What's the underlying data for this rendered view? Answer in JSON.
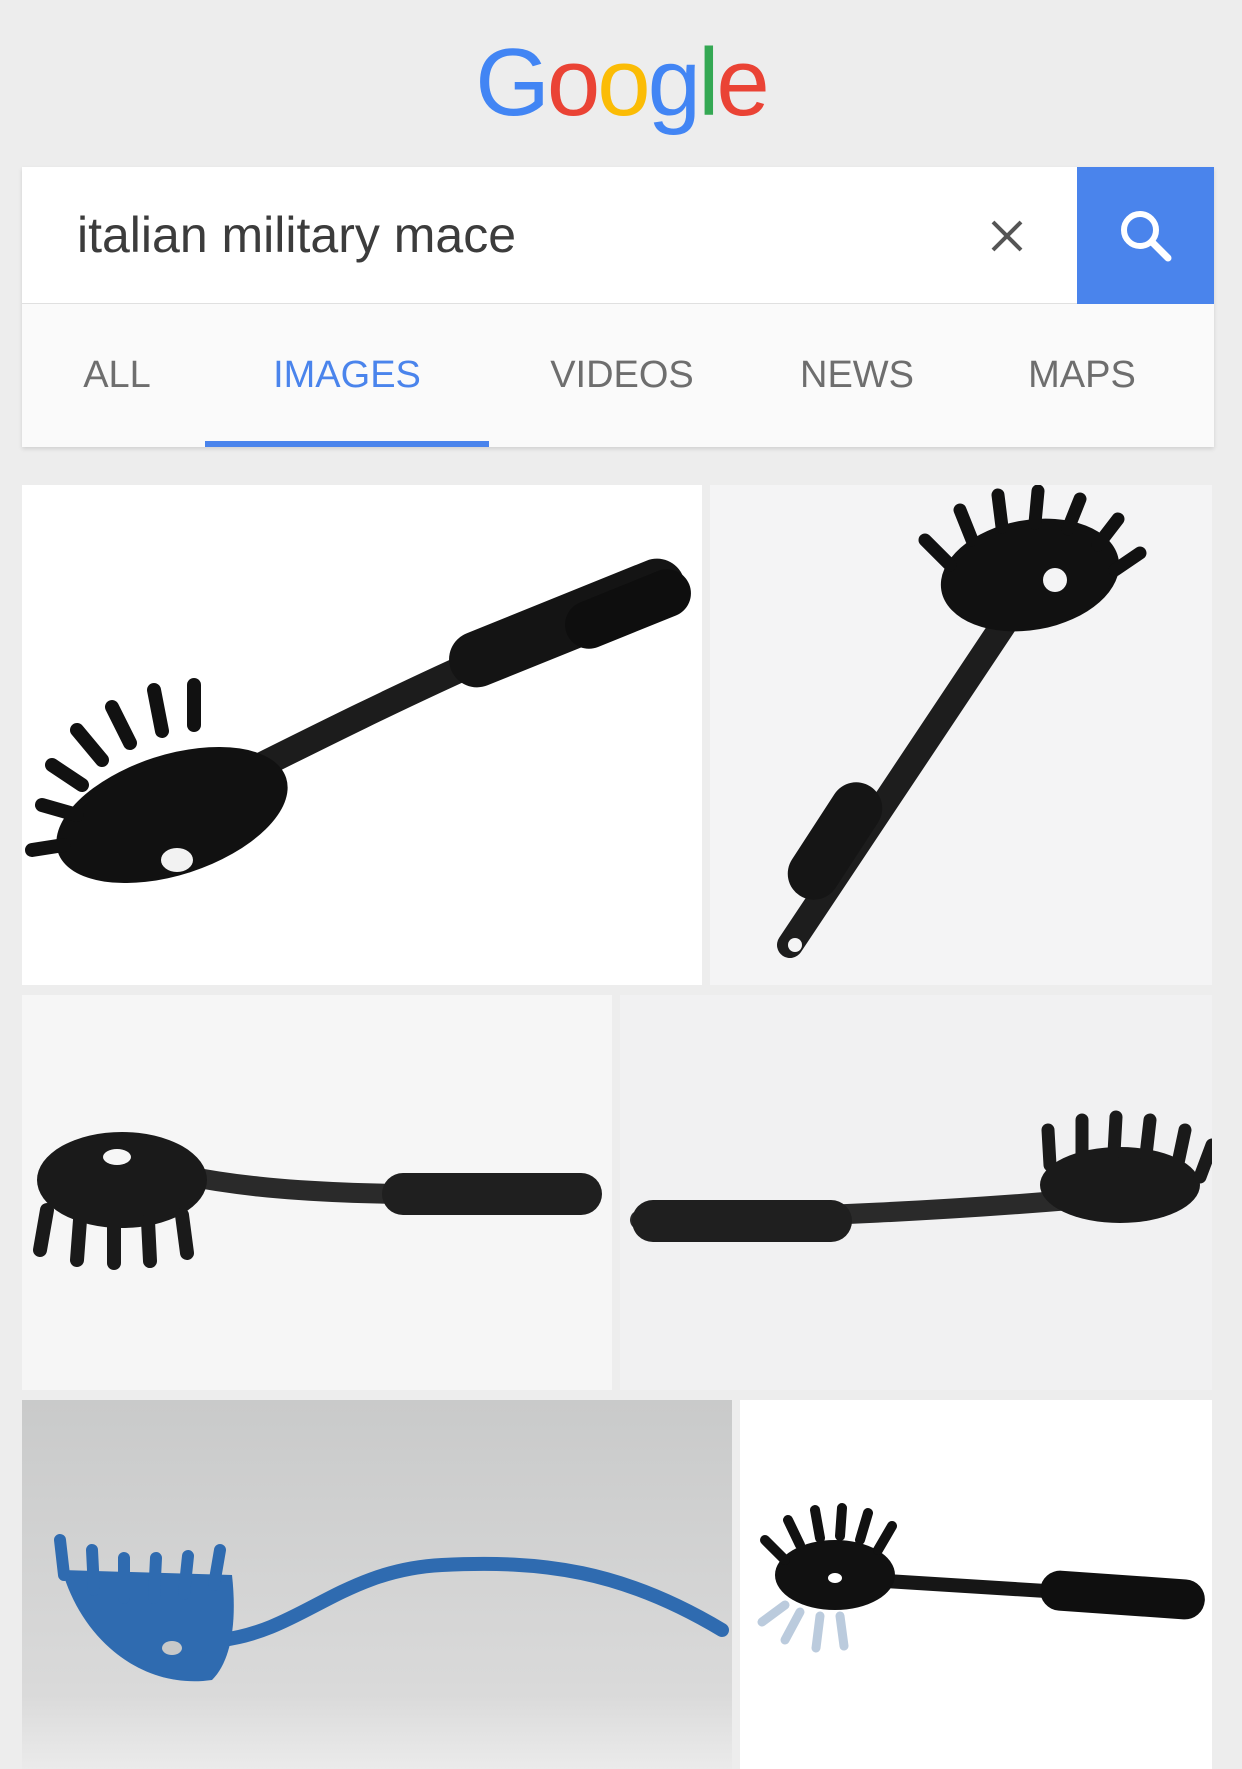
{
  "logo": {
    "letters": [
      "G",
      "o",
      "o",
      "g",
      "l",
      "e"
    ],
    "colors": [
      "#4285f4",
      "#ea4335",
      "#fbbc05",
      "#4285f4",
      "#34a853",
      "#ea4335"
    ]
  },
  "search": {
    "query": "italian military mace",
    "clear_icon": "close-icon",
    "search_icon": "search-icon",
    "button_color": "#4a84ec"
  },
  "tabs": [
    {
      "label": "ALL",
      "active": false
    },
    {
      "label": "IMAGES",
      "active": true
    },
    {
      "label": "VIDEOS",
      "active": false
    },
    {
      "label": "NEWS",
      "active": false
    },
    {
      "label": "MAPS",
      "active": false
    }
  ],
  "results": [
    {
      "subject": "black spaghetti server diagonal, head bottom-left"
    },
    {
      "subject": "black spaghetti server diagonal, head top-right"
    },
    {
      "subject": "black spaghetti server horizontal, head left"
    },
    {
      "subject": "black spaghetti server horizontal, head right"
    },
    {
      "subject": "blue spaghetti server curved"
    },
    {
      "subject": "black spaghetti server small with reflection"
    }
  ]
}
